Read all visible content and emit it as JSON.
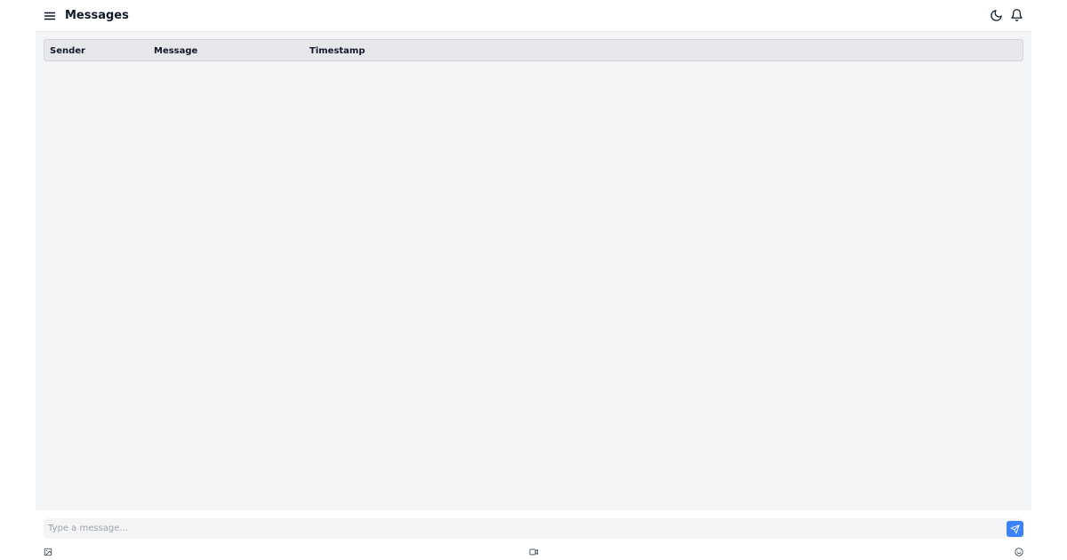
{
  "header": {
    "title": "Messages",
    "icons": [
      "menu-icon",
      "moon-icon",
      "bell-icon"
    ]
  },
  "table": {
    "columns": [
      "Sender",
      "Message",
      "Timestamp"
    ],
    "rows": []
  },
  "composer": {
    "placeholder": "Type a message...",
    "value": "",
    "icons": [
      "send-icon",
      "image-icon",
      "video-icon",
      "emoji-icon"
    ]
  },
  "colors": {
    "accent": "#3b82f6",
    "main_background": "#f3f4f6",
    "header_row_background": "#e5e7eb"
  }
}
